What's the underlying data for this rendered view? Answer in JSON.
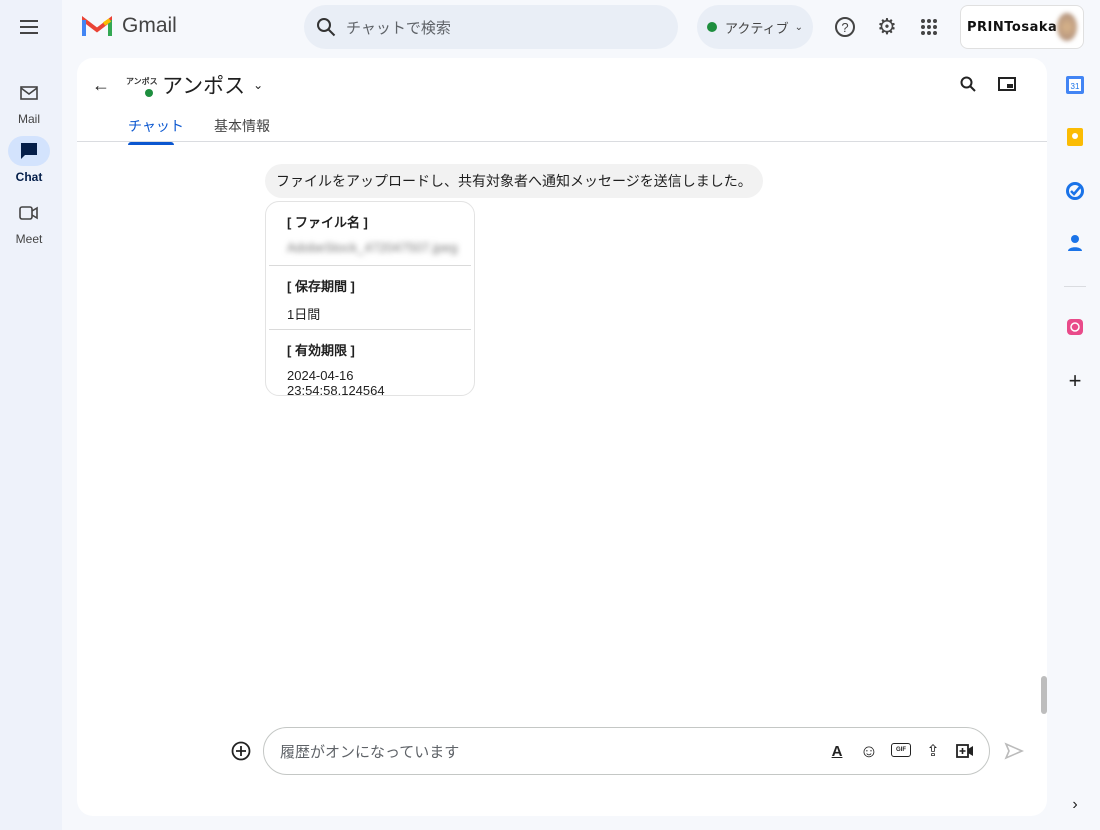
{
  "app": {
    "title": "Gmail"
  },
  "rail": {
    "items": [
      {
        "label": "Mail",
        "icon": "mail-icon"
      },
      {
        "label": "Chat",
        "icon": "chat-icon",
        "active": true
      },
      {
        "label": "Meet",
        "icon": "video-icon"
      }
    ]
  },
  "header": {
    "search_placeholder": "チャットで検索",
    "status": "アクティブ",
    "status_color": "#1e8e3e",
    "account_brand": "PRINTosaka"
  },
  "chat": {
    "name": "アンポス",
    "avatar_text": "アンポス",
    "tabs": [
      {
        "label": "チャット",
        "active": true
      },
      {
        "label": "基本情報"
      }
    ]
  },
  "messages": {
    "system": "ファイルをアップロードし、共有対象者へ通知メッセージを送信しました。",
    "card": [
      {
        "key": "[ ファイル名 ]",
        "value": "AdobeStock_472047507.jpeg",
        "blurred": true
      },
      {
        "key": "[ 保存期間 ]",
        "value": "1日間"
      },
      {
        "key": "[ 有効期限 ]",
        "value": "2024-04-16 23:54:58.124564"
      }
    ]
  },
  "composer": {
    "placeholder": "履歴がオンになっています"
  },
  "colors": {
    "accent": "#0b57d0",
    "background": "#f6f8fc"
  }
}
